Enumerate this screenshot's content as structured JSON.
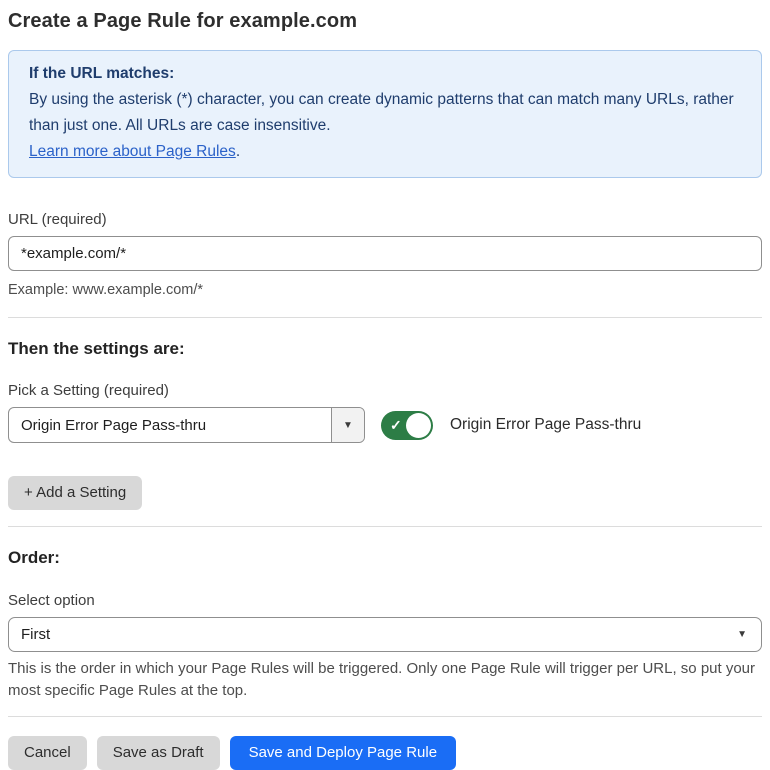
{
  "page": {
    "title": "Create a Page Rule for example.com"
  },
  "info_box": {
    "heading": "If the URL matches:",
    "body": "By using the asterisk (*) character, you can create dynamic patterns that can match many URLs, rather than just one. All URLs are case insensitive.",
    "link_label": "Learn more about Page Rules",
    "link_suffix": ".",
    "background_color": "#e9f2fc",
    "border_color": "#abc9ec",
    "text_color": "#1f3d6d",
    "link_color": "#2b62c9"
  },
  "url_field": {
    "label": "URL (required)",
    "value": "*example.com/*",
    "helper": "Example: www.example.com/*"
  },
  "settings_section": {
    "heading": "Then the settings are:",
    "pick_label": "Pick a Setting (required)",
    "selected_setting": "Origin Error Page Pass-thru",
    "toggle": {
      "state": "on",
      "label": "Origin Error Page Pass-thru",
      "on_color": "#2d7d46"
    },
    "add_button_label": "+ Add a Setting"
  },
  "order_section": {
    "heading": "Order:",
    "select_label": "Select option",
    "selected_option": "First",
    "helper": "This is the order in which your Page Rules will be triggered. Only one Page Rule will trigger per URL, so put your most specific Page Rules at the top."
  },
  "footer": {
    "cancel_label": "Cancel",
    "save_draft_label": "Save as Draft",
    "save_deploy_label": "Save and Deploy Page Rule",
    "primary_color": "#1a6df5",
    "secondary_color": "#d8d8d8"
  },
  "icons": {
    "dropdown_arrow": "▼",
    "toggle_check": "✓"
  }
}
